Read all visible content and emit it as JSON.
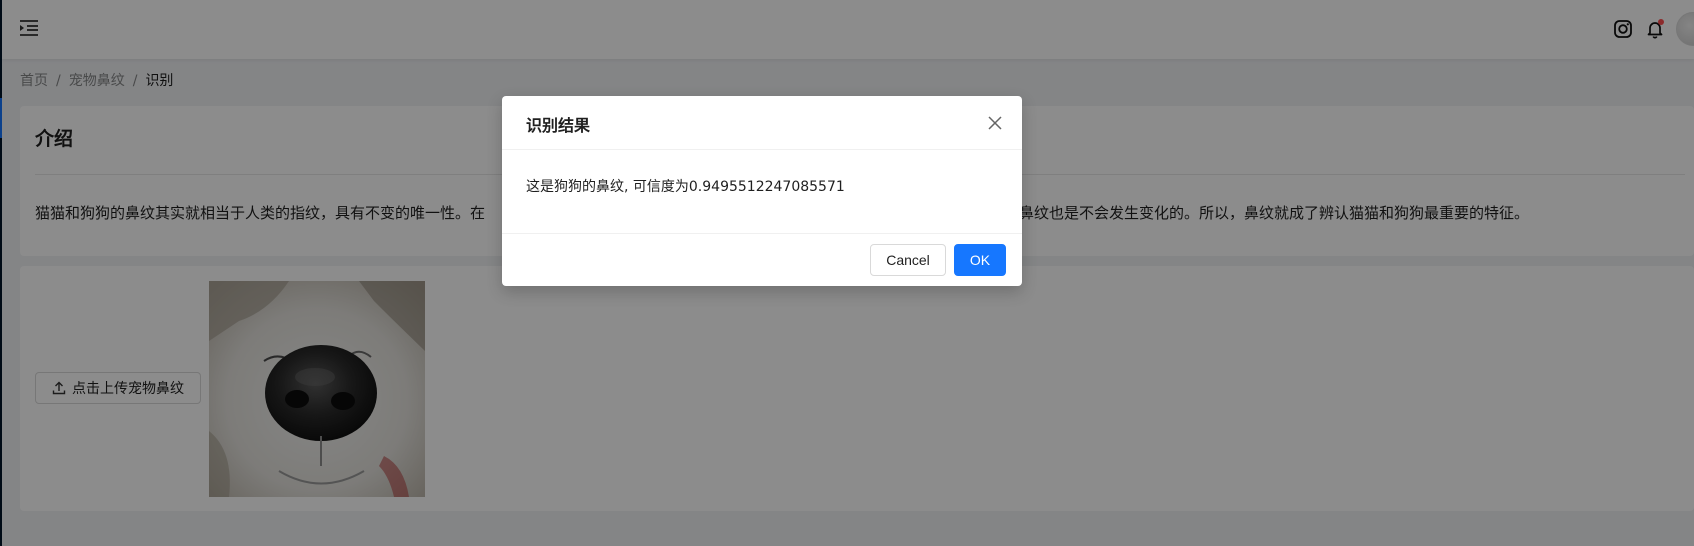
{
  "header": {
    "menu_icon": "menu-fold-icon",
    "instagram_icon": "instagram-icon",
    "bell_icon": "bell-icon",
    "avatar_icon": "user-avatar"
  },
  "breadcrumb": {
    "items": [
      "首页",
      "宠物鼻纹",
      "识别"
    ],
    "separator": "/"
  },
  "intro": {
    "title": "介绍",
    "text": "猫猫和狗狗的鼻纹其实就相当于人类的指纹，具有不变的唯一性。在",
    "text_tail": "中，鼻纹也是不会发生变化的。所以，鼻纹就成了辨认猫猫和狗狗最重要的特征。"
  },
  "upload": {
    "button_label": "点击上传宠物鼻纹",
    "icon": "upload-icon",
    "image": "dog-nose-photo"
  },
  "modal": {
    "title": "识别结果",
    "message": "这是狗狗的鼻纹, 可信度为0.9495512247085571",
    "cancel_label": "Cancel",
    "ok_label": "OK"
  },
  "colors": {
    "primary": "#1677ff",
    "mask": "rgba(0,0,0,0.45)",
    "background": "#f0f2f5",
    "notification_dot": "#ff4d4f"
  }
}
